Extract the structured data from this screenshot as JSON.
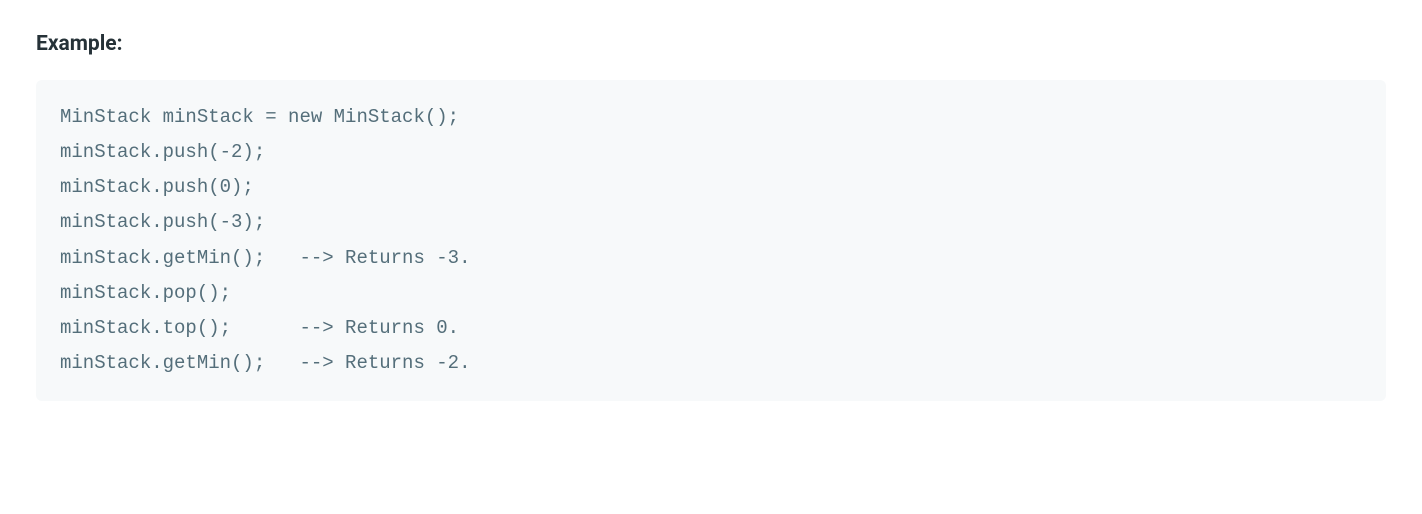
{
  "heading": "Example:",
  "code": "MinStack minStack = new MinStack();\nminStack.push(-2);\nminStack.push(0);\nminStack.push(-3);\nminStack.getMin();   --> Returns -3.\nminStack.pop();\nminStack.top();      --> Returns 0.\nminStack.getMin();   --> Returns -2."
}
